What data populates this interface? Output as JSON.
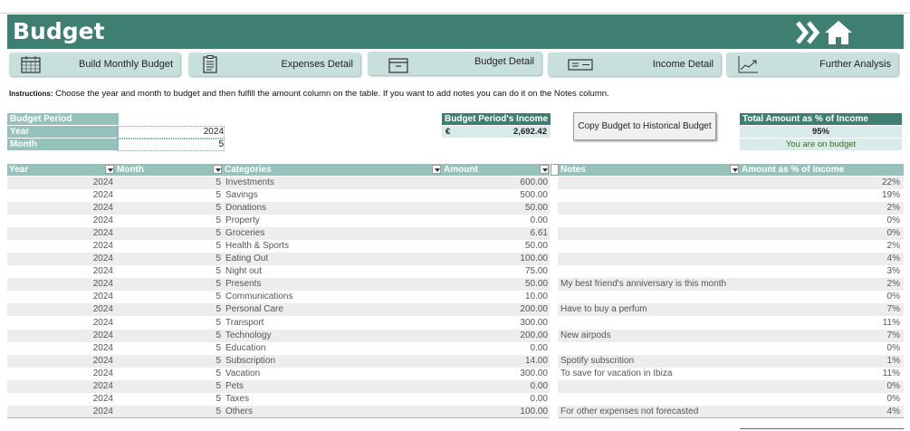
{
  "header": {
    "title": "Budget"
  },
  "nav": [
    {
      "label": "Build Monthly Budget",
      "icon": "calendar-icon"
    },
    {
      "label": "Expenses Detail",
      "icon": "clipboard-icon"
    },
    {
      "label": "Budget Detail",
      "icon": "box-icon"
    },
    {
      "label": "Income Detail",
      "icon": "money-icon"
    },
    {
      "label": "Further Analysis",
      "icon": "trend-chart-icon"
    }
  ],
  "instructions": {
    "label": "Instructions:",
    "text": "Choose the year and month to budget and then fulfill the amount column on the table. If you want to add notes you can do it on the Notes column."
  },
  "period": {
    "header": "Budget Period",
    "year_label": "Year",
    "year_value": "2024",
    "month_label": "Month",
    "month_value": "5"
  },
  "income": {
    "header": "Budget Period's Income",
    "currency": "€",
    "value": "2,692.42"
  },
  "copy_button": "Copy Budget to Historical Budget",
  "total": {
    "header": "Total Amount as % of Income",
    "value": "95%",
    "status": "You are on budget"
  },
  "table": {
    "columns": [
      "Year",
      "Month",
      "Categories",
      "Amount",
      "Notes",
      "Amount as % of Income"
    ],
    "rows": [
      [
        "2024",
        "5",
        "Investments",
        "600.00",
        "",
        "22%"
      ],
      [
        "2024",
        "5",
        "Savings",
        "500.00",
        "",
        "19%"
      ],
      [
        "2024",
        "5",
        "Donations",
        "50.00",
        "",
        "2%"
      ],
      [
        "2024",
        "5",
        "Property",
        "0.00",
        "",
        "0%"
      ],
      [
        "2024",
        "5",
        "Groceries",
        "6.61",
        "",
        "0%"
      ],
      [
        "2024",
        "5",
        "Health & Sports",
        "50.00",
        "",
        "2%"
      ],
      [
        "2024",
        "5",
        "Eating Out",
        "100.00",
        "",
        "4%"
      ],
      [
        "2024",
        "5",
        "Night out",
        "75.00",
        "",
        "3%"
      ],
      [
        "2024",
        "5",
        "Presents",
        "50.00",
        "My best friend's anniversary is this month",
        "2%"
      ],
      [
        "2024",
        "5",
        "Communications",
        "10.00",
        "",
        "0%"
      ],
      [
        "2024",
        "5",
        "Personal Care",
        "200.00",
        "Have to buy a perfum",
        "7%"
      ],
      [
        "2024",
        "5",
        "Transport",
        "300.00",
        "",
        "11%"
      ],
      [
        "2024",
        "5",
        "Technology",
        "200.00",
        "New airpods",
        "7%"
      ],
      [
        "2024",
        "5",
        "Education",
        "0.00",
        "",
        "0%"
      ],
      [
        "2024",
        "5",
        "Subscription",
        "14.00",
        "Spotify subscrition",
        "1%"
      ],
      [
        "2024",
        "5",
        "Vacation",
        "300.00",
        "To save for vacation in Ibiza",
        "11%"
      ],
      [
        "2024",
        "5",
        "Pets",
        "0.00",
        "",
        "0%"
      ],
      [
        "2024",
        "5",
        "Taxes",
        "0.00",
        "",
        "0%"
      ],
      [
        "2024",
        "5",
        "Others",
        "100.00",
        "For other expenses not forecasted",
        "4%"
      ]
    ]
  },
  "colors": {
    "accent": "#3f7f72",
    "header_light": "#97c2bc",
    "button_bg": "#c8e0dc",
    "status_bg": "#d9ebe8"
  }
}
